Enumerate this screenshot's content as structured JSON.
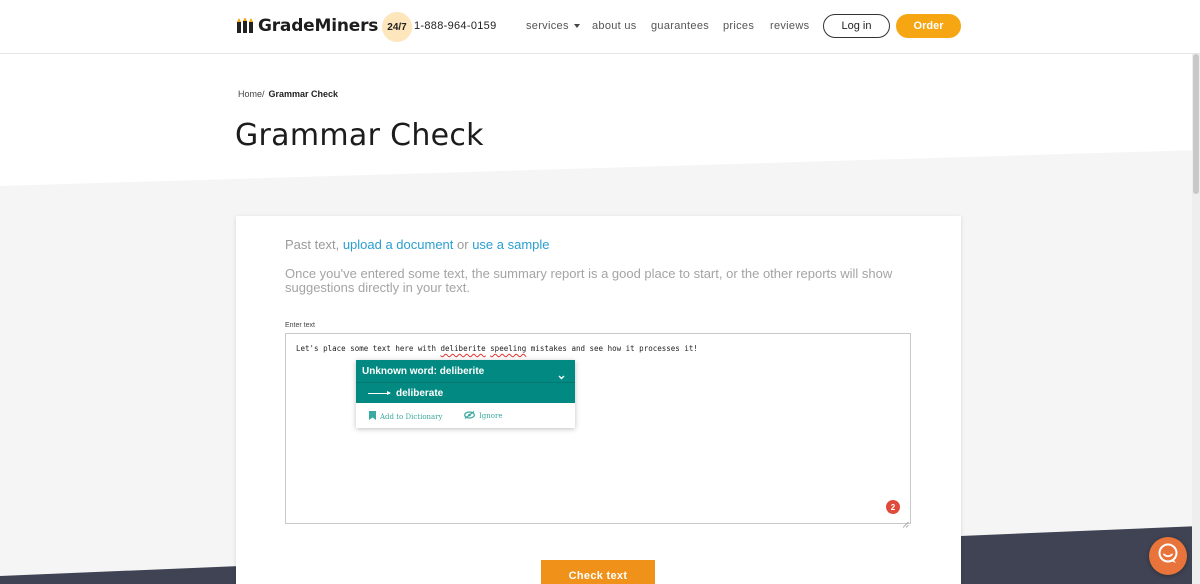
{
  "header": {
    "logo_text": "GradeMiners",
    "badge": "24/7",
    "phone": "1-888-964-0159",
    "nav": [
      {
        "label": "services",
        "has_caret": true
      },
      {
        "label": "about us"
      },
      {
        "label": "guarantees"
      },
      {
        "label": "prices"
      },
      {
        "label": "reviews"
      }
    ],
    "login_label": "Log in",
    "order_label": "Order"
  },
  "breadcrumb": {
    "home": "Home/",
    "current": "Grammar Check"
  },
  "page_title": "Grammar Check",
  "card": {
    "intro_prefix": "Past text, ",
    "intro_link1": "upload a document",
    "intro_mid": " or ",
    "intro_link2": "use a sample",
    "description": "Once you've entered some text, the summary report is a good place to start, or the other reports will show suggestions directly in your text.",
    "field_label": "Enter text",
    "text": {
      "part1": "Let's place some text here with ",
      "err1": "deliberite",
      "part2": " ",
      "err2": "speeling",
      "part3": " mistakes and see how it processes it!"
    },
    "error_count": "2",
    "popup": {
      "title": "Unknown word: deliberite",
      "suggestion": "deliberate",
      "add_label": "Add to Dictionary",
      "ignore_label": "Ignore"
    },
    "check_label": "Check text"
  },
  "colors": {
    "accent_orange": "#f6a612",
    "check_orange": "#f09119",
    "teal": "#028a82",
    "link_blue": "#2a9ed1",
    "error_red": "#e04a3b",
    "dark_band": "#3f4353"
  },
  "icons": {
    "logo": "pencils-icon",
    "caret": "caret-down-icon",
    "chevron": "chevron-down-icon",
    "bookmark": "bookmark-icon",
    "ignore": "eye-slash-icon",
    "chat": "chat-bubble-icon"
  }
}
